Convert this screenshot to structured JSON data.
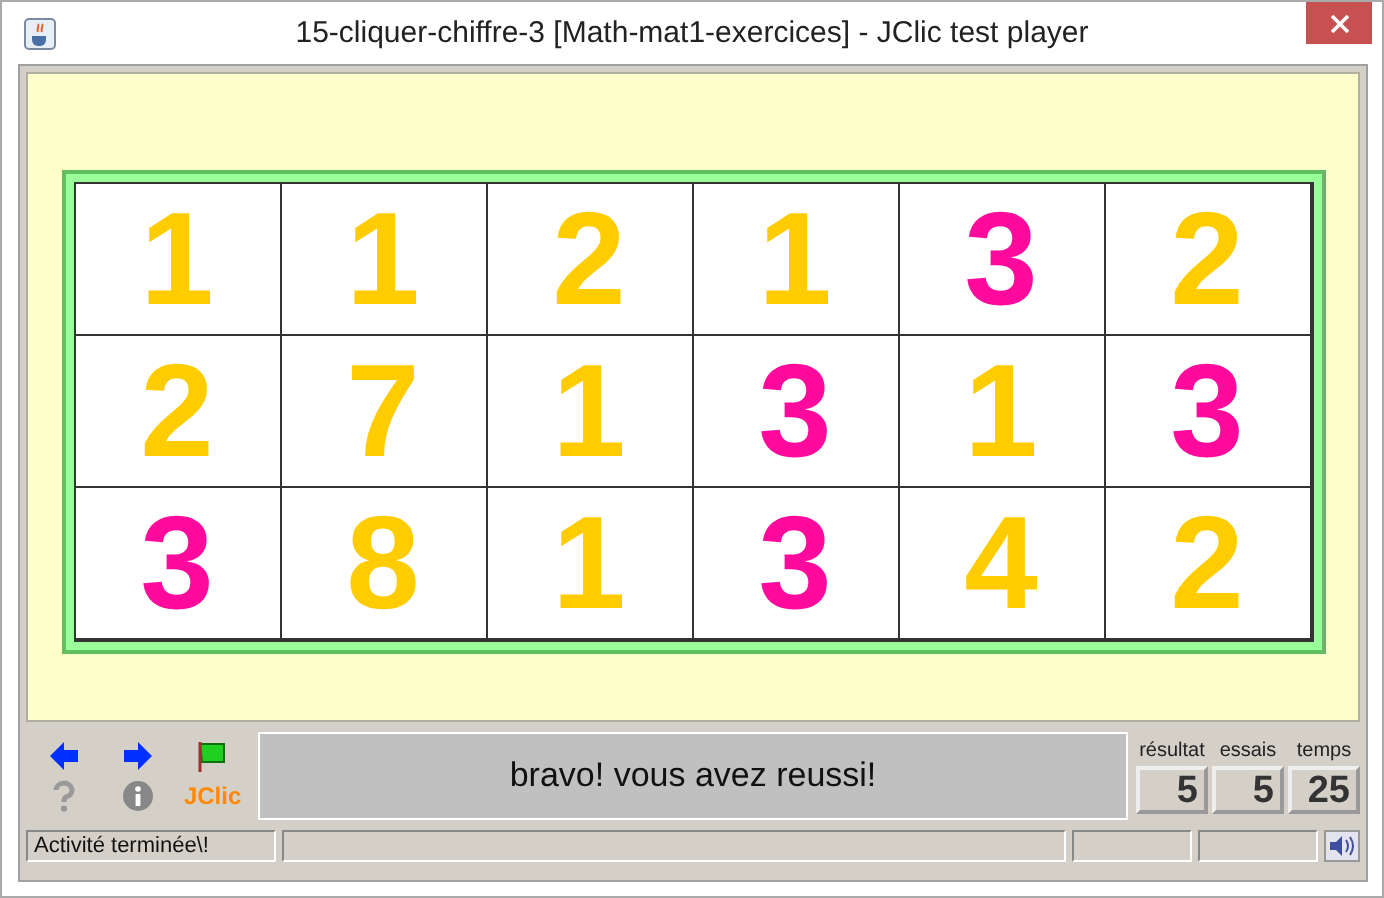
{
  "window": {
    "title": "15-cliquer-chiffre-3 [Math-mat1-exercices] - JClic test player"
  },
  "grid": {
    "rows": [
      [
        {
          "text": "1",
          "color": "#ffcc00"
        },
        {
          "text": "1",
          "color": "#ffcc00"
        },
        {
          "text": "2",
          "color": "#ffcc00"
        },
        {
          "text": "1",
          "color": "#ffcc00"
        },
        {
          "text": "3",
          "color": "#ff0a9c"
        },
        {
          "text": "2",
          "color": "#ffcc00"
        }
      ],
      [
        {
          "text": "2",
          "color": "#ffcc00"
        },
        {
          "text": "7",
          "color": "#ffcc00"
        },
        {
          "text": "1",
          "color": "#ffcc00"
        },
        {
          "text": "3",
          "color": "#ff0a9c"
        },
        {
          "text": "1",
          "color": "#ffcc00"
        },
        {
          "text": "3",
          "color": "#ff0a9c"
        }
      ],
      [
        {
          "text": "3",
          "color": "#ff0a9c"
        },
        {
          "text": "8",
          "color": "#ffcc00"
        },
        {
          "text": "1",
          "color": "#ffcc00"
        },
        {
          "text": "3",
          "color": "#ff0a9c"
        },
        {
          "text": "4",
          "color": "#ffcc00"
        },
        {
          "text": "2",
          "color": "#ffcc00"
        }
      ]
    ]
  },
  "toolbar": {
    "logo": "JClic"
  },
  "message": "bravo! vous avez reussi!",
  "counters": [
    {
      "label": "résultat",
      "value": "5"
    },
    {
      "label": "essais",
      "value": "5"
    },
    {
      "label": "temps",
      "value": "25"
    }
  ],
  "status_bar": {
    "text": "Activité terminée\\!"
  }
}
